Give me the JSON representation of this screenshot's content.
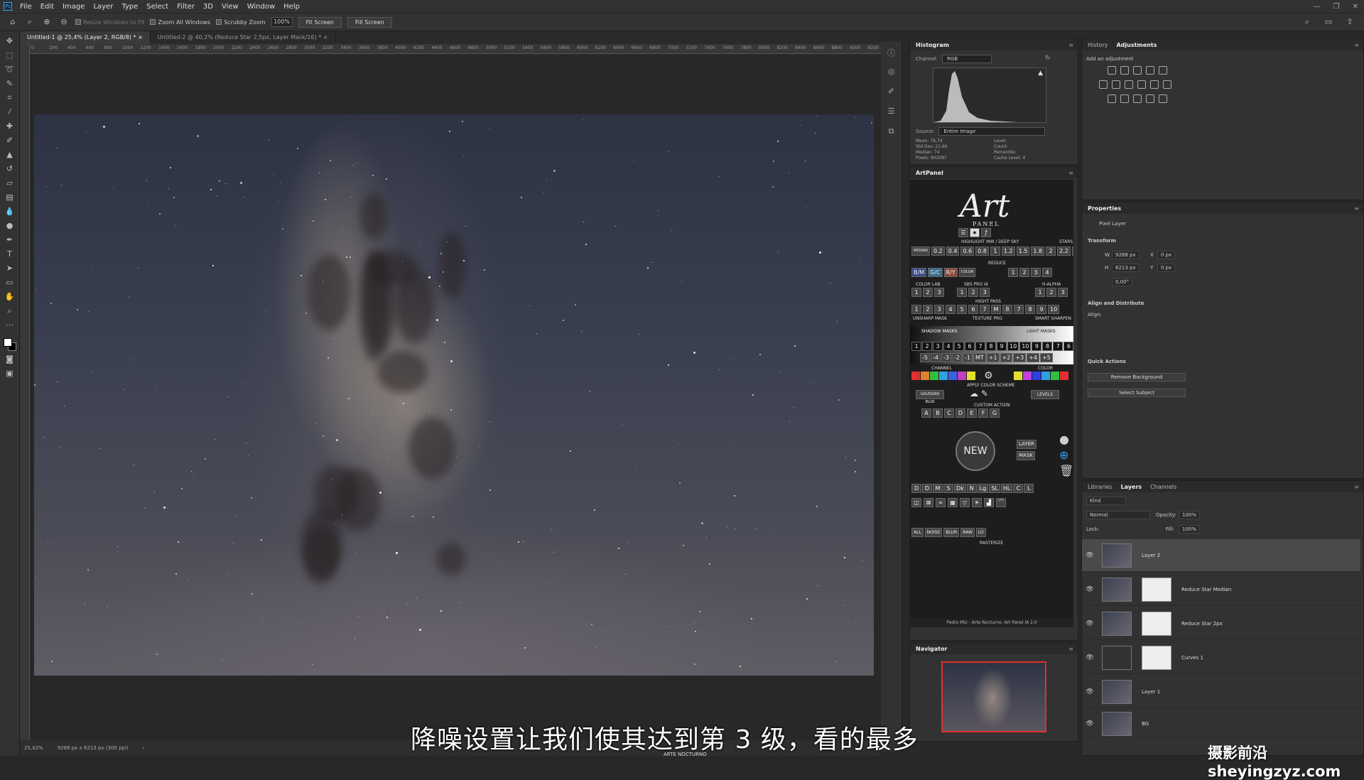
{
  "menubar": {
    "items": [
      "File",
      "Edit",
      "Image",
      "Layer",
      "Type",
      "Select",
      "Filter",
      "3D",
      "View",
      "Window",
      "Help"
    ]
  },
  "options": {
    "resize_windows": "Resize Windows to Fit",
    "zoom_all": "Zoom All Windows",
    "scrubby": "Scrubby Zoom",
    "zoom_value": "100%",
    "fit_screen": "Fit Screen",
    "fill_screen": "Fill Screen"
  },
  "tabs": [
    {
      "label": "Untitled-1 @ 25,4% (Layer 2, RGB/8) *"
    },
    {
      "label": "Untitled-2 @ 40,2% (Reduce Star 2,5px, Layer Mask/16) *"
    }
  ],
  "ruler_ticks": [
    "0",
    "200",
    "400",
    "600",
    "800",
    "1000",
    "1200",
    "1400",
    "1600",
    "1800",
    "2000",
    "2200",
    "2400",
    "2600",
    "2800",
    "3000",
    "3200",
    "3400",
    "3600",
    "3800",
    "4000",
    "4200",
    "4400",
    "4600",
    "4800",
    "5000",
    "5200",
    "5400",
    "5600",
    "5800",
    "6000",
    "6200",
    "6400",
    "6600",
    "6800",
    "7000",
    "7200",
    "7400",
    "7600",
    "7800",
    "8000",
    "8200",
    "8400",
    "8600",
    "8800",
    "9000",
    "9200"
  ],
  "status": {
    "zoom": "25,42%",
    "size": "9288 px x 6213 px (300 ppi)"
  },
  "histogram": {
    "title": "Histogram",
    "channel_label": "Channel:",
    "channel": "RGB",
    "source_label": "Source:",
    "source": "Entire Image",
    "stats": [
      "Mean: 76,74",
      "Std Dev: 21,66",
      "Median: 74",
      "Pixels: 902097"
    ],
    "stats2": [
      "Level:",
      "Count:",
      "Percentile:",
      "Cache Level: 4"
    ]
  },
  "artpanel": {
    "title": "ArtPanel",
    "logo": "Art",
    "logo_sub": "PANEL",
    "highlight_label": "HIGHLIGHT MW / DEEP SKY",
    "stars_label": "STARS",
    "median_label": "MEDIAN",
    "highlight_values": [
      "0.2",
      "0.4",
      "0.6",
      "0.8",
      "1",
      "1.2",
      "1.5",
      "1.8",
      "2",
      "2.2",
      "2.5"
    ],
    "reduce_label": "REDUCE",
    "bgc": [
      "B/M",
      "G/C",
      "R/Y"
    ],
    "color_label": "COLOR",
    "reduce_values": [
      "1",
      "2",
      "3",
      "4"
    ],
    "colorlab_label": "COLOR LAB",
    "colorlab_values": [
      "1",
      "2",
      "3"
    ],
    "sbs_label": "SBS PRO IA",
    "sbs_values": [
      "1",
      "2",
      "3"
    ],
    "halpha_label": "H-ALPHA",
    "halpha_values": [
      "1",
      "2",
      "3"
    ],
    "highpass_label": "HIGHT PASS",
    "highpass_values": [
      "1",
      "2",
      "3",
      "4",
      "5",
      "6",
      "7",
      "M",
      "8",
      "7",
      "8",
      "9",
      "10"
    ],
    "unsharp_label": "UNSHARP MASK",
    "texture_label": "TEXTURE PRO",
    "smart_label": "SMART SHARPEN",
    "shadow_label": "SHADOW MASKS",
    "light_label": "LIGHT MASKS",
    "mask_values": [
      "1",
      "2",
      "3",
      "4",
      "5",
      "6",
      "7",
      "8",
      "9",
      "10",
      "10",
      "9",
      "8",
      "7",
      "6",
      "5",
      "4",
      "3",
      "2",
      "1"
    ],
    "ev_values": [
      "-5",
      "-4",
      "-3",
      "-2",
      "-1",
      "MT",
      "+1",
      "+2",
      "+3",
      "+4",
      "+5"
    ],
    "channel_label": "CHANNEL",
    "color2_label": "COLOR",
    "apply_label": "APPLY COLOR SCHEME",
    "gauss_label": "GAUSSIAN BLUR",
    "levels_label": "LEVELS",
    "custom_label": "CUSTOM ACTION",
    "custom_values": [
      "A",
      "B",
      "C",
      "D",
      "E",
      "F",
      "G"
    ],
    "new_label": "NEW",
    "layer_label": "LAYER",
    "mask_label": "MASK",
    "row1": [
      "D",
      "D",
      "M",
      "S",
      "Dk",
      "N",
      "Lg",
      "SL",
      "HL",
      "C",
      "L"
    ],
    "noise_label": "NOISE",
    "blur_label": "BLUR",
    "raw_label": "RAW",
    "lo_label": "LO",
    "all_label": "ALL",
    "rasterize_label": "RASTERIZE",
    "footer": "Pedro Mtz - Arte Nocturno. Art Panel IA 2.0",
    "colors_left": [
      "#e03030",
      "#e08030",
      "#30c040",
      "#30a0e0",
      "#4060e0",
      "#c040c0",
      "#e0e030"
    ],
    "colors_right": [
      "#e0e030",
      "#c040e0",
      "#3040e0",
      "#30a0e0",
      "#30c040",
      "#e03030"
    ]
  },
  "navigator": {
    "title": "Navigator"
  },
  "history_adj": {
    "tab_history": "History",
    "tab_adjustments": "Adjustments",
    "add_label": "Add an adjustment"
  },
  "properties": {
    "title": "Properties",
    "pixel_layer": "Pixel Layer",
    "transform": "Transform",
    "w_label": "W",
    "w": "9288 px",
    "x_label": "X",
    "x": "0 px",
    "h_label": "H",
    "h": "6213 px",
    "y_label": "Y",
    "y": "0 px",
    "angle": "0,00°",
    "align_label": "Align and Distribute",
    "align_sub": "Align:",
    "quick_label": "Quick Actions",
    "remove_bg": "Remove Background",
    "select_subject": "Select Subject"
  },
  "layers_panel": {
    "tab_libraries": "Libraries",
    "tab_layers": "Layers",
    "tab_channels": "Channels",
    "kind": "Kind",
    "blend": "Normal",
    "opacity_label": "Opacity:",
    "opacity": "100%",
    "lock_label": "Lock:",
    "fill_label": "Fill:",
    "fill": "100%",
    "layers": [
      {
        "name": "Layer 2"
      },
      {
        "name": "Reduce Star Median"
      },
      {
        "name": "Reduce Star 2px"
      },
      {
        "name": "Curves 1"
      },
      {
        "name": "Layer 1"
      },
      {
        "name": "BG"
      }
    ]
  },
  "subtitle": "降噪设置让我们使其达到第 3 级，看的最多",
  "watermark": "摄影前沿 sheyingzyz.com",
  "watermark2": "ARTE NOCTURNO"
}
